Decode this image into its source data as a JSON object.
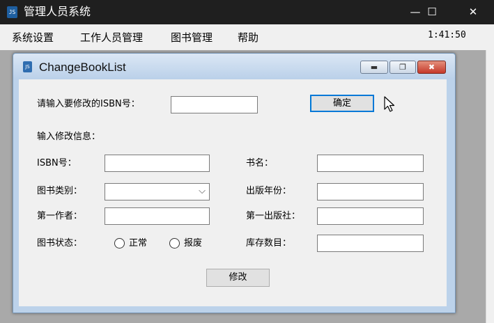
{
  "app": {
    "title": "管理人员系统",
    "minimize_glyph": "—",
    "maximize_glyph": "☐",
    "close_glyph": "✕"
  },
  "menu": {
    "items": [
      "系统设置",
      "工作人员管理",
      "图书管理",
      "帮助"
    ],
    "clock": "1:41:50"
  },
  "child": {
    "title": "ChangeBookList",
    "minimize_glyph": "▬",
    "restore_glyph": "❐",
    "close_glyph": "✖"
  },
  "form": {
    "isbn_prompt": "请输入要修改的ISBN号：",
    "isbn_prompt_value": "",
    "confirm_button": "确定",
    "section_label": "输入修改信息：",
    "isbn_label": "ISBN号：",
    "isbn_value": "",
    "title_label": "书名：",
    "title_value": "",
    "category_label": "图书类别：",
    "category_value": "",
    "pub_year_label": "出版年份：",
    "pub_year_value": "",
    "author_label": "第一作者：",
    "author_value": "",
    "publisher_label": "第一出版社：",
    "publisher_value": "",
    "status_label": "图书状态：",
    "status_options": [
      "正常",
      "报废"
    ],
    "stock_label": "库存数目：",
    "stock_value": "",
    "modify_button": "修改"
  },
  "icons": [
    "app-book-icon",
    "child-book-icon",
    "mouse-cursor-icon",
    "chevron-down-icon"
  ]
}
